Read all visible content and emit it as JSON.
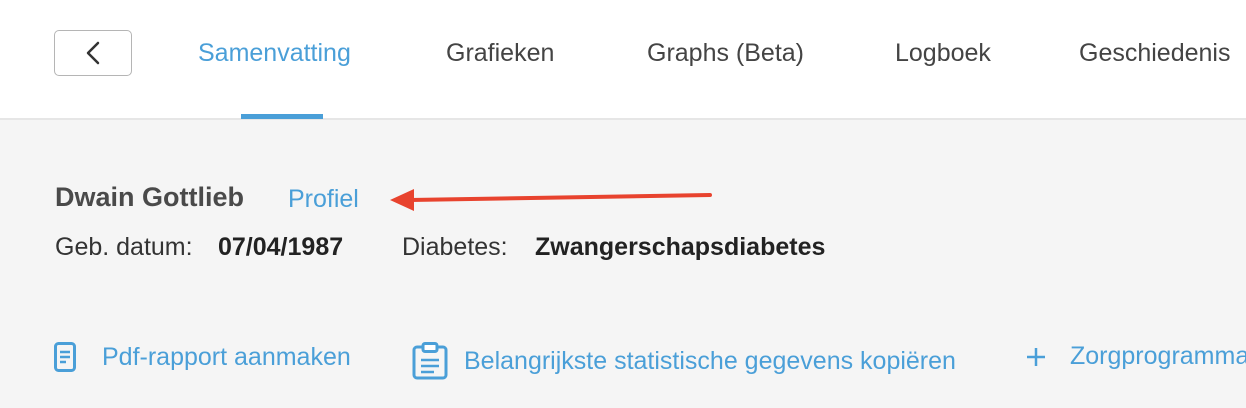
{
  "nav": {
    "tabs": [
      {
        "label": "Samenvatting",
        "active": true
      },
      {
        "label": "Grafieken",
        "active": false
      },
      {
        "label": "Graphs (Beta)",
        "active": false
      },
      {
        "label": "Logboek",
        "active": false
      },
      {
        "label": "Geschiedenis",
        "active": false
      }
    ],
    "back_icon": "chevron-left-icon"
  },
  "patient": {
    "name": "Dwain Gottlieb",
    "profile_link": "Profiel",
    "dob_label": "Geb. datum:",
    "dob_value": "07/04/1987",
    "diabetes_label": "Diabetes:",
    "diabetes_value": "Zwangerschapsdiabetes"
  },
  "actions": [
    {
      "label": "Pdf-rapport aanmaken",
      "icon": "document-icon"
    },
    {
      "label": "Belangrijkste statistische gegevens kopiëren",
      "icon": "clipboard-icon"
    },
    {
      "label": "Zorgprogramma",
      "icon": "plus-icon"
    }
  ],
  "colors": {
    "accent": "#4a9fd8",
    "annotation_arrow": "#e8432e",
    "page_background": "#f5f5f5"
  }
}
